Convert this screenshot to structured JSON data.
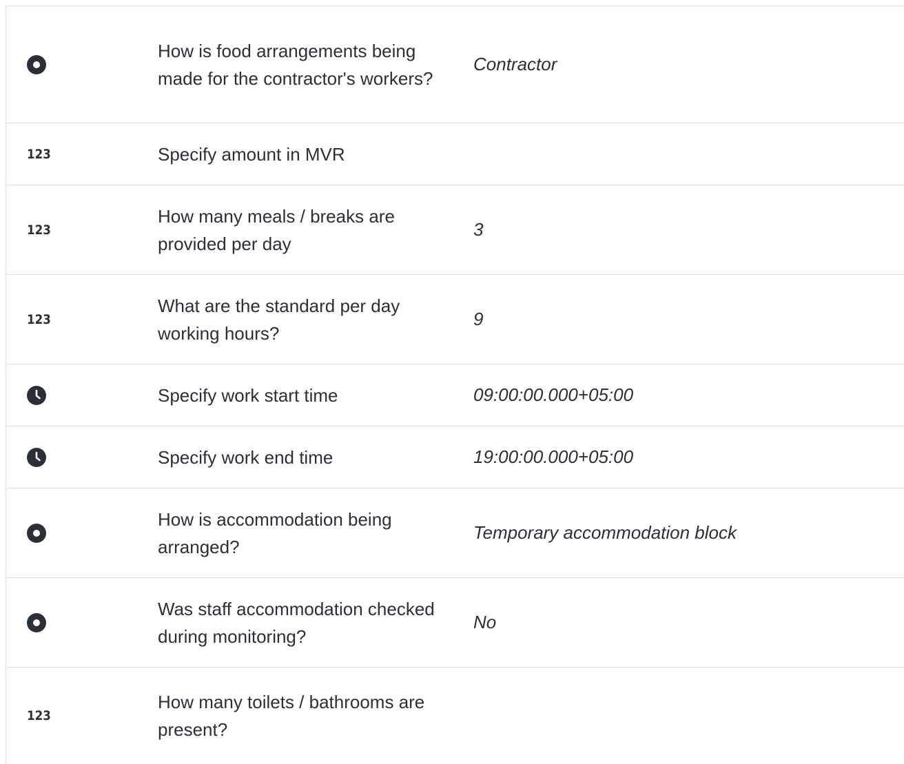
{
  "rows": [
    {
      "icon": "radio-icon",
      "question": "How is food arrangements being made for the contractor's workers?",
      "answer": "Contractor"
    },
    {
      "icon": "number-icon",
      "icon_text": "123",
      "question": "Specify amount in MVR",
      "answer": ""
    },
    {
      "icon": "number-icon",
      "icon_text": "123",
      "question": "How many meals / breaks are provided per day",
      "answer": "3"
    },
    {
      "icon": "number-icon",
      "icon_text": "123",
      "question": "What are the standard per day working hours?",
      "answer": "9"
    },
    {
      "icon": "clock-icon",
      "question": "Specify work start time",
      "answer": "09:00:00.000+05:00"
    },
    {
      "icon": "clock-icon",
      "question": "Specify work end time",
      "answer": "19:00:00.000+05:00"
    },
    {
      "icon": "radio-icon",
      "question": "How is accommodation being arranged?",
      "answer": "Temporary accommodation block"
    },
    {
      "icon": "radio-icon",
      "question": "Was staff accommodation checked during monitoring?",
      "answer": "No"
    },
    {
      "icon": "number-icon",
      "icon_text": "123",
      "question": "How many toilets / bathrooms are present?",
      "answer": ""
    }
  ],
  "colors": {
    "text": "#2b2f38",
    "border": "#dadde2",
    "background": "#ffffff"
  }
}
